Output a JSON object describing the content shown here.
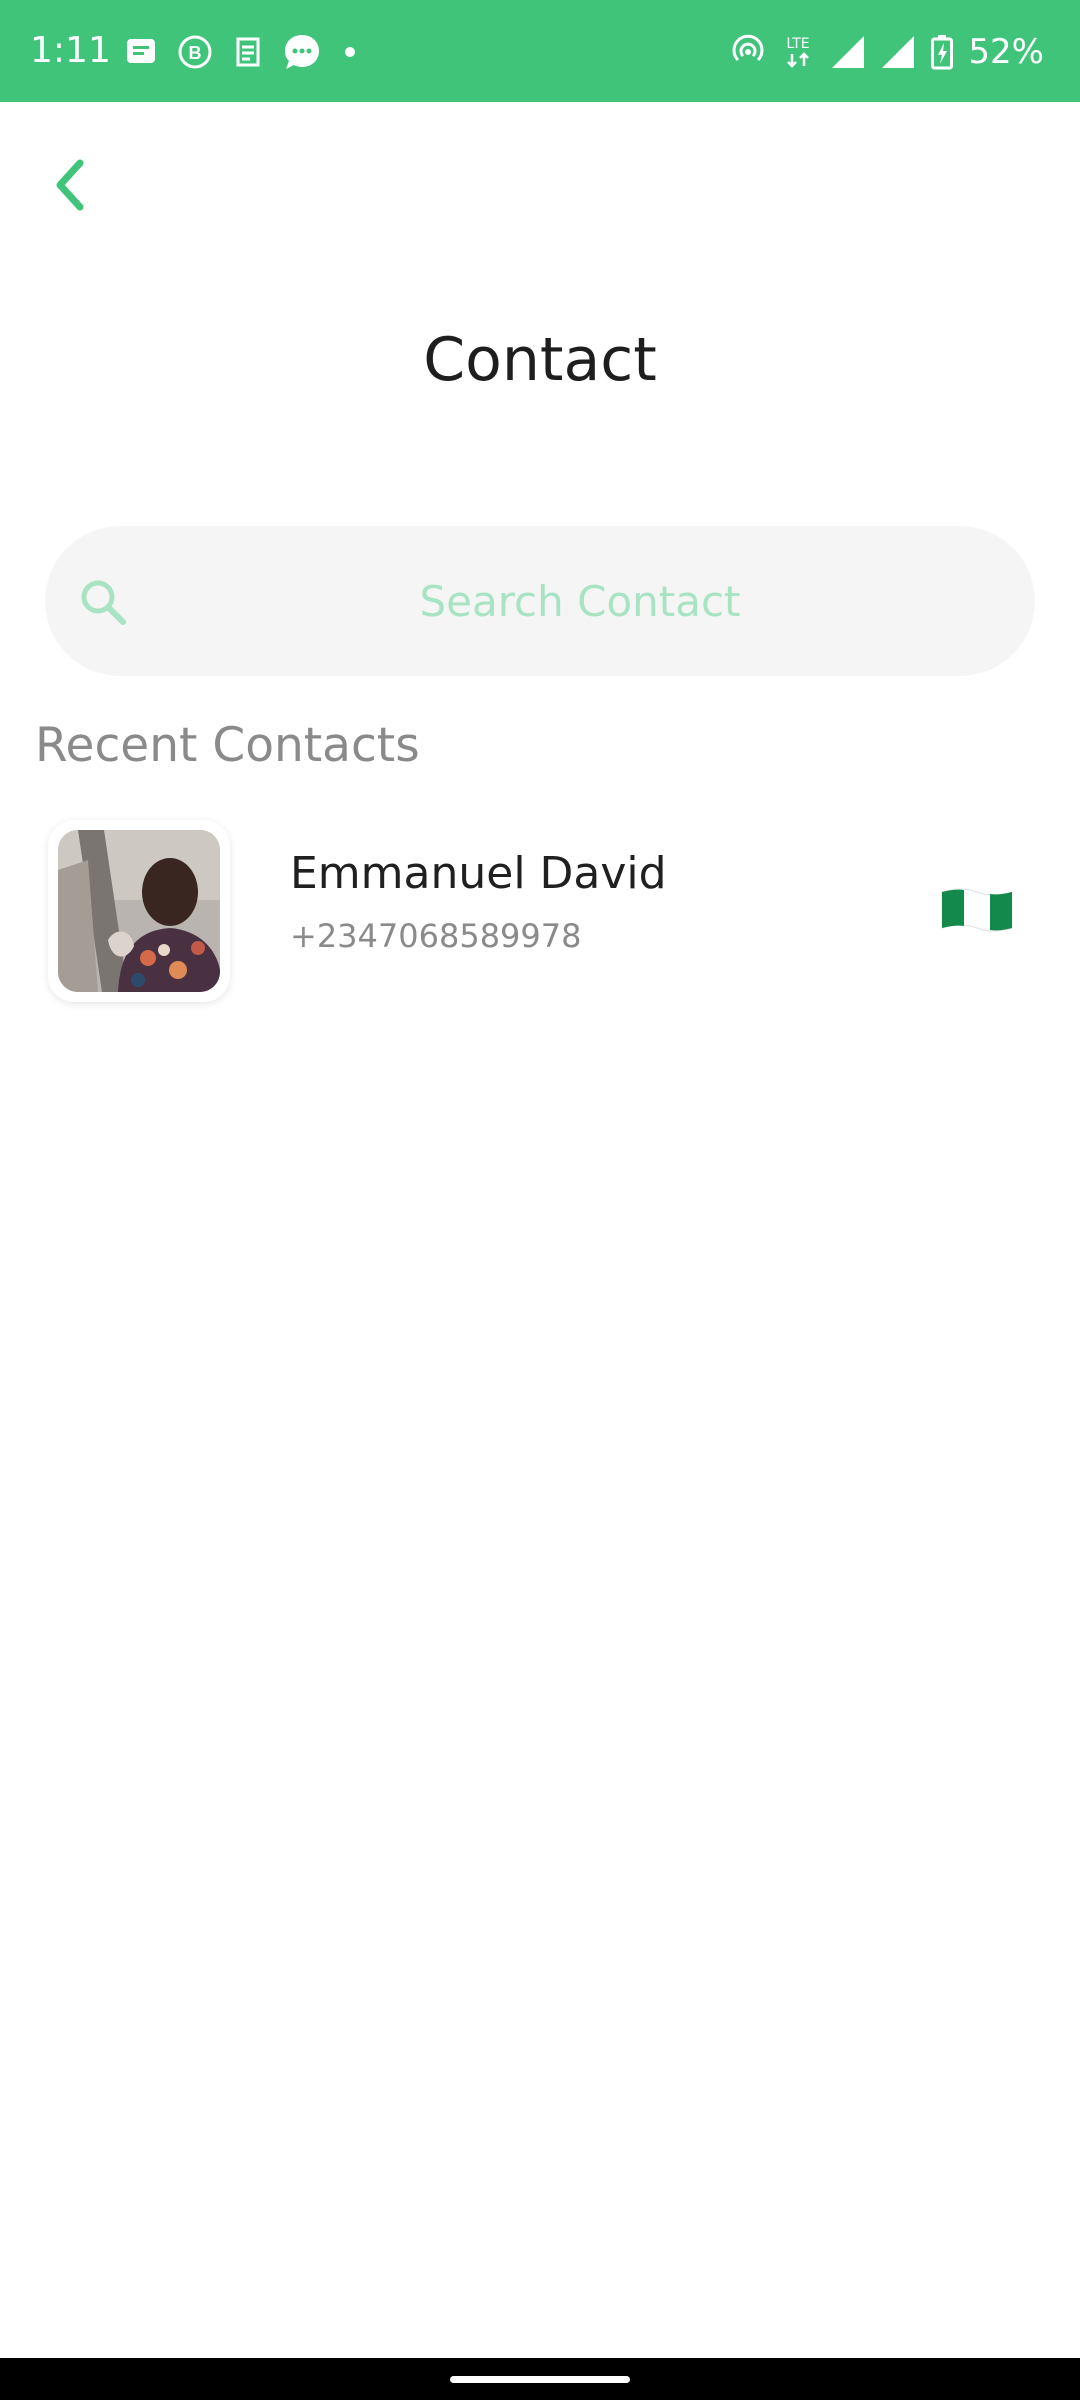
{
  "status_bar": {
    "time": "1:11",
    "battery": "52%",
    "background_color": "#3fc47a",
    "notification_icons": [
      "message-icon",
      "business-chat-icon",
      "app-icon",
      "chat-bubble-icon",
      "more-dot-icon"
    ],
    "system_icons": [
      "hotspot-icon",
      "lte-icon",
      "signal-icon",
      "signal-icon",
      "battery-charging-icon"
    ]
  },
  "header": {
    "back_icon": "chevron-left-icon",
    "title": "Contact",
    "accent_color": "#3fc47a"
  },
  "search": {
    "icon": "search-icon",
    "placeholder": "Search Contact",
    "value": ""
  },
  "recent_contacts": {
    "heading": "Recent Contacts",
    "items": [
      {
        "name": "Emmanuel David",
        "phone": "+2347068589978",
        "avatar": "contact-photo",
        "flag": "nigeria-flag-icon"
      }
    ]
  }
}
